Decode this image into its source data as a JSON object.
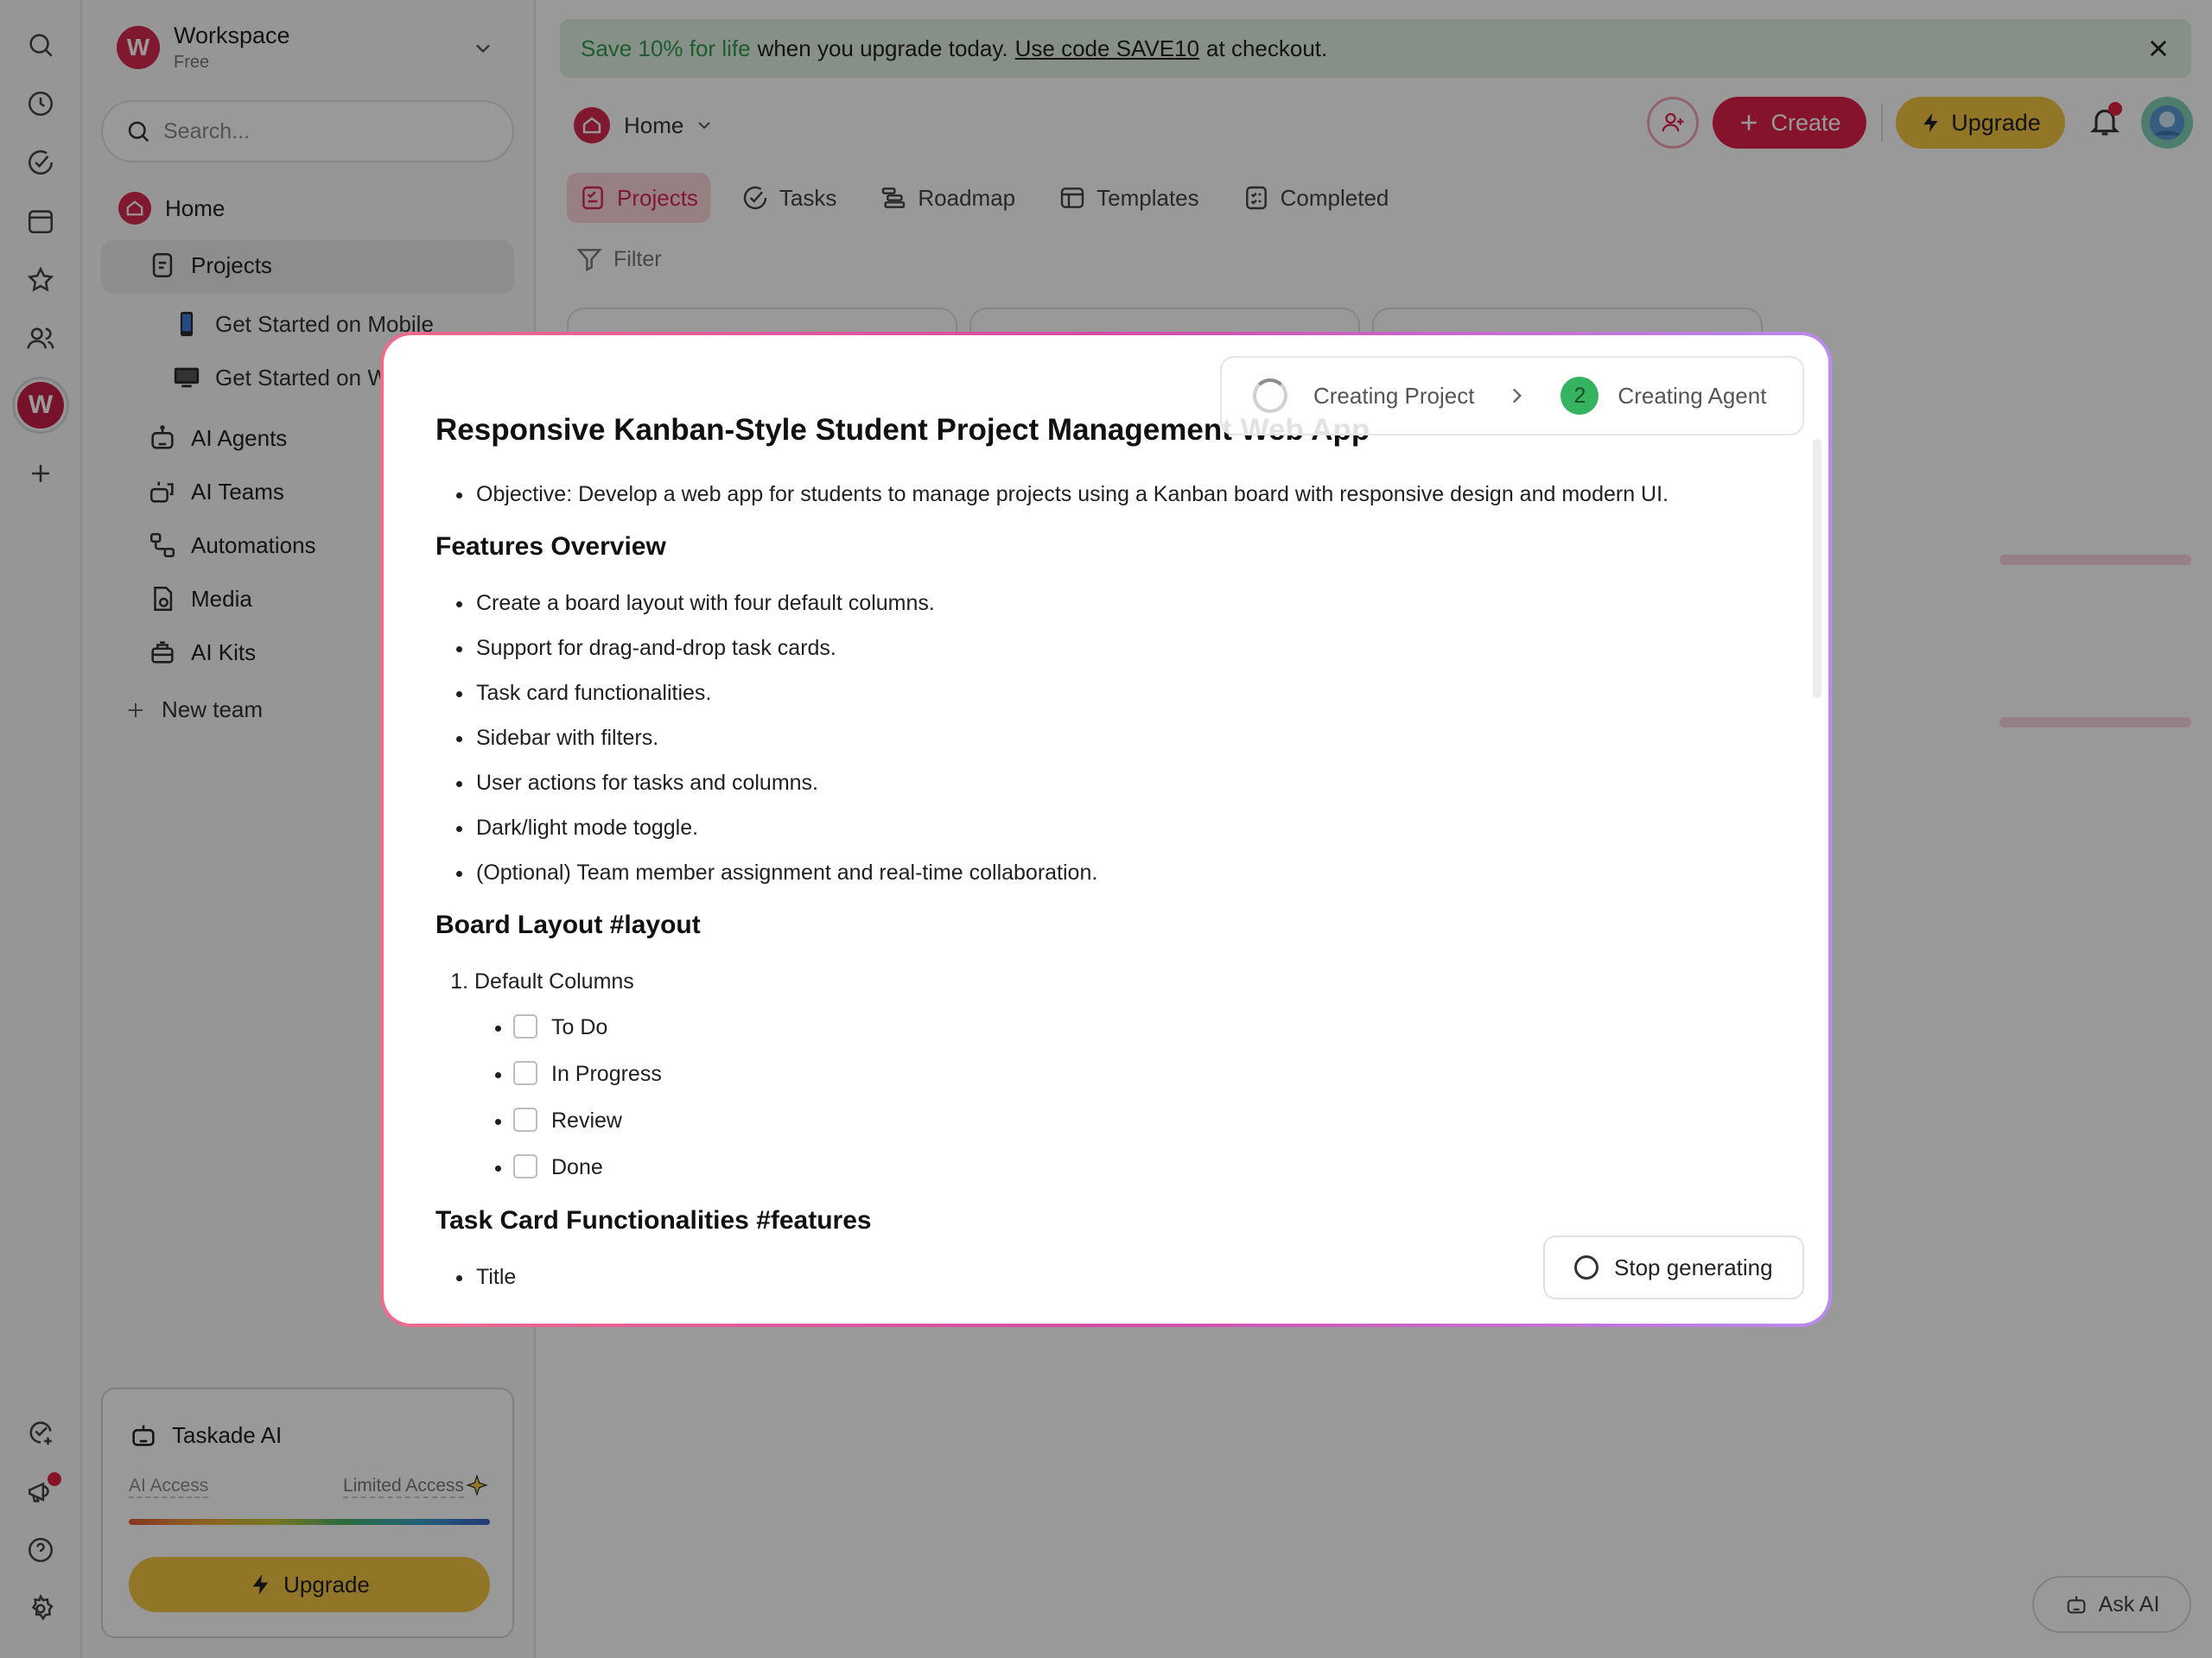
{
  "rail": {
    "workspace_initial": "W",
    "icons": [
      "search-icon",
      "clock-icon",
      "check-circle-icon",
      "calendar-icon",
      "star-icon",
      "users-icon",
      "workspace-icon",
      "plus-icon",
      "check-plus-icon",
      "megaphone-icon",
      "help-icon",
      "gear-icon"
    ]
  },
  "sidebar": {
    "workspace": {
      "initial": "W",
      "name": "Workspace",
      "plan": "Free"
    },
    "search_placeholder": "Search...",
    "items": {
      "home": "Home",
      "projects": "Projects",
      "mobile": "Get Started on Mobile",
      "web": "Get Started on Web",
      "ai_agents": "AI Agents",
      "ai_teams": "AI Teams",
      "automations": "Automations",
      "media": "Media",
      "ai_kits": "AI Kits",
      "new_team": "New team"
    },
    "ai_card": {
      "title": "Taskade AI",
      "access_label": "AI Access",
      "access_value": "Limited Access",
      "upgrade_label": "Upgrade"
    }
  },
  "main": {
    "promo": {
      "highlight": "Save 10% for life",
      "text": "when you upgrade today.",
      "code": "Use code SAVE10",
      "suffix": "at checkout."
    },
    "breadcrumb": "Home",
    "buttons": {
      "create": "Create",
      "upgrade": "Upgrade"
    },
    "tabs": [
      "Projects",
      "Tasks",
      "Roadmap",
      "Templates",
      "Completed"
    ],
    "filter": "Filter",
    "ask_ai": "Ask AI"
  },
  "modal": {
    "steps": {
      "step1": "Creating Project",
      "step2_number": "2",
      "step2": "Creating Agent"
    },
    "title": "Responsive Kanban-Style Student Project Management Web App",
    "objective": "Objective: Develop a web app for students to manage projects using a Kanban board with responsive design and modern UI.",
    "features_heading": "Features Overview",
    "features": [
      "Create a board layout with four default columns.",
      "Support for drag-and-drop task cards.",
      "Task card functionalities.",
      "Sidebar with filters.",
      "User actions for tasks and columns.",
      "Dark/light mode toggle.",
      "(Optional) Team member assignment and real-time collaboration."
    ],
    "layout_heading": "Board Layout #layout",
    "default_columns_label": "Default Columns",
    "columns": [
      "To Do",
      "In Progress",
      "Review",
      "Done"
    ],
    "task_card_heading": "Task Card Functionalities #features",
    "task_card_first": "Title",
    "stop_label": "Stop generating"
  },
  "colors": {
    "brand": "#d6284f",
    "create": "#e0204a",
    "upgrade": "#f3c544",
    "step_done": "#36b35f",
    "promo_bg": "#dff1e3"
  }
}
